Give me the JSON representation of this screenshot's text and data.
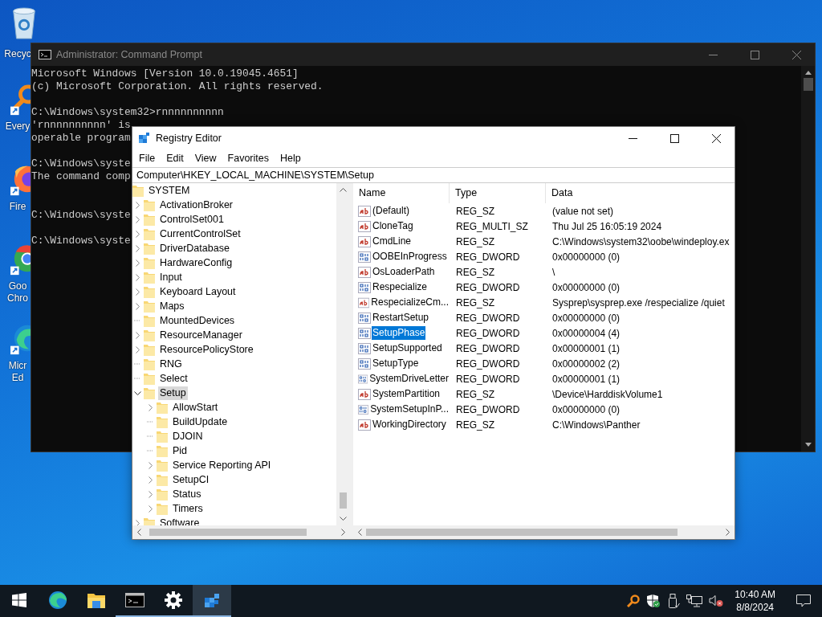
{
  "desktop_icons": [
    {
      "kind": "recycle",
      "label_lines": [
        "Recyc"
      ]
    },
    {
      "kind": "search",
      "label_lines": [
        "Every"
      ]
    },
    {
      "kind": "firefox",
      "label_lines": [
        "Fire"
      ]
    },
    {
      "kind": "chrome",
      "label_lines": [
        "Goo",
        "Chro"
      ]
    },
    {
      "kind": "edge",
      "label_lines": [
        "Micr",
        "Ed"
      ]
    }
  ],
  "command_prompt": {
    "title": "Administrator: Command Prompt",
    "blocks": [
      [
        "Microsoft Windows [Version 10.0.19045.4651]",
        "(c) Microsoft Corporation. All rights reserved."
      ],
      [
        "C:\\Windows\\system32>rnnnnnnnnnn",
        "'rnnnnnnnnnn' is",
        "operable program"
      ],
      [
        "C:\\Windows\\syste",
        "The command comp"
      ],
      [
        "C:\\Windows\\syste"
      ],
      [
        "C:\\Windows\\syste"
      ]
    ]
  },
  "registry_editor": {
    "title": "Registry Editor",
    "menu": [
      "File",
      "Edit",
      "View",
      "Favorites",
      "Help"
    ],
    "address": "Computer\\HKEY_LOCAL_MACHINE\\SYSTEM\\Setup",
    "tree": {
      "label": "SYSTEM",
      "children": [
        {
          "label": "ActivationBroker",
          "expandable": true,
          "expanded": false,
          "selected": false
        },
        {
          "label": "ControlSet001",
          "expandable": true,
          "expanded": false,
          "selected": false
        },
        {
          "label": "CurrentControlSet",
          "expandable": true,
          "expanded": false,
          "selected": false
        },
        {
          "label": "DriverDatabase",
          "expandable": true,
          "expanded": false,
          "selected": false
        },
        {
          "label": "HardwareConfig",
          "expandable": true,
          "expanded": false,
          "selected": false
        },
        {
          "label": "Input",
          "expandable": true,
          "expanded": false,
          "selected": false
        },
        {
          "label": "Keyboard Layout",
          "expandable": true,
          "expanded": false,
          "selected": false
        },
        {
          "label": "Maps",
          "expandable": true,
          "expanded": false,
          "selected": false
        },
        {
          "label": "MountedDevices",
          "expandable": false,
          "selected": false
        },
        {
          "label": "ResourceManager",
          "expandable": true,
          "expanded": false,
          "selected": false
        },
        {
          "label": "ResourcePolicyStore",
          "expandable": true,
          "expanded": false,
          "selected": false
        },
        {
          "label": "RNG",
          "expandable": false,
          "selected": false
        },
        {
          "label": "Select",
          "expandable": false,
          "selected": false
        },
        {
          "label": "Setup",
          "expandable": true,
          "expanded": true,
          "selected": true,
          "children": [
            {
              "label": "AllowStart",
              "expandable": true,
              "expanded": false,
              "selected": false
            },
            {
              "label": "BuildUpdate",
              "expandable": false,
              "selected": false
            },
            {
              "label": "DJOIN",
              "expandable": false,
              "selected": false
            },
            {
              "label": "Pid",
              "expandable": false,
              "selected": false
            },
            {
              "label": "Service Reporting API",
              "expandable": true,
              "expanded": false,
              "selected": false
            },
            {
              "label": "SetupCI",
              "expandable": true,
              "expanded": false,
              "selected": false
            },
            {
              "label": "Status",
              "expandable": true,
              "expanded": false,
              "selected": false
            },
            {
              "label": "Timers",
              "expandable": true,
              "expanded": false,
              "selected": false
            }
          ]
        },
        {
          "label": "Software",
          "expandable": true,
          "expanded": false,
          "selected": false
        }
      ]
    },
    "values": {
      "columns": [
        "Name",
        "Type",
        "Data"
      ],
      "rows": [
        {
          "kind": "string",
          "name": "(Default)",
          "type": "REG_SZ",
          "data": "(value not set)",
          "selected": false
        },
        {
          "kind": "string",
          "name": "CloneTag",
          "type": "REG_MULTI_SZ",
          "data": "Thu Jul 25 16:05:19 2024",
          "selected": false
        },
        {
          "kind": "string",
          "name": "CmdLine",
          "type": "REG_SZ",
          "data": "C:\\Windows\\system32\\oobe\\windeploy.ex",
          "selected": false
        },
        {
          "kind": "binary",
          "name": "OOBEInProgress",
          "type": "REG_DWORD",
          "data": "0x00000000 (0)",
          "selected": false
        },
        {
          "kind": "string",
          "name": "OsLoaderPath",
          "type": "REG_SZ",
          "data": "\\",
          "selected": false
        },
        {
          "kind": "binary",
          "name": "Respecialize",
          "type": "REG_DWORD",
          "data": "0x00000000 (0)",
          "selected": false
        },
        {
          "kind": "string",
          "name": "RespecializeCm...",
          "type": "REG_SZ",
          "data": "Sysprep\\sysprep.exe /respecialize /quiet",
          "selected": false
        },
        {
          "kind": "binary",
          "name": "RestartSetup",
          "type": "REG_DWORD",
          "data": "0x00000000 (0)",
          "selected": false
        },
        {
          "kind": "binary",
          "name": "SetupPhase",
          "type": "REG_DWORD",
          "data": "0x00000004 (4)",
          "selected": true
        },
        {
          "kind": "binary",
          "name": "SetupSupported",
          "type": "REG_DWORD",
          "data": "0x00000001 (1)",
          "selected": false
        },
        {
          "kind": "binary",
          "name": "SetupType",
          "type": "REG_DWORD",
          "data": "0x00000002 (2)",
          "selected": false
        },
        {
          "kind": "binary",
          "name": "SystemDriveLetter",
          "type": "REG_DWORD",
          "data": "0x00000001 (1)",
          "selected": false
        },
        {
          "kind": "string",
          "name": "SystemPartition",
          "type": "REG_SZ",
          "data": "\\Device\\HarddiskVolume1",
          "selected": false
        },
        {
          "kind": "binary",
          "name": "SystemSetupInP...",
          "type": "REG_DWORD",
          "data": "0x00000000 (0)",
          "selected": false
        },
        {
          "kind": "string",
          "name": "WorkingDirectory",
          "type": "REG_SZ",
          "data": "C:\\Windows\\Panther",
          "selected": false
        }
      ]
    }
  },
  "taskbar": {
    "apps": [
      {
        "kind": "start",
        "running": false,
        "active": false
      },
      {
        "kind": "edge",
        "running": false,
        "active": false
      },
      {
        "kind": "explorer",
        "running": false,
        "active": false
      },
      {
        "kind": "cmd",
        "running": true,
        "active": false
      },
      {
        "kind": "settings",
        "running": true,
        "active": false
      },
      {
        "kind": "regedit",
        "running": true,
        "active": true
      }
    ],
    "clock": {
      "time": "10:40 AM",
      "date": "8/8/2024"
    }
  }
}
